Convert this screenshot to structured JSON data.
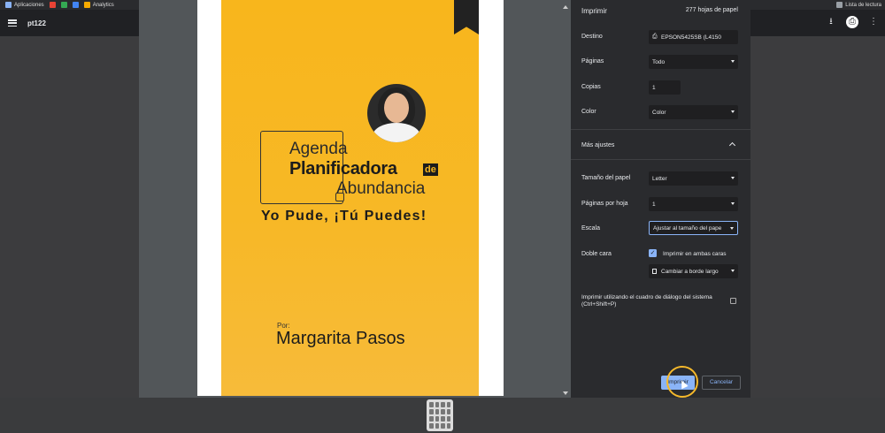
{
  "bookmarks": {
    "apps_label": "Aplicaciones",
    "analytics_label": "Analytics",
    "reading_list_label": "Lista de lectura"
  },
  "toolbar": {
    "doc_title": "pt122"
  },
  "cover": {
    "line1": "Agenda",
    "line2": "Planificadora",
    "line2_suffix": "de",
    "line3": "Abundancia",
    "slogan": "Yo Pude, ¡Tú Puedes!",
    "by": "Por:",
    "author": "Margarita Pasos"
  },
  "print_panel": {
    "title": "Imprimir",
    "sheet_count": "277 hojas de papel",
    "destination": {
      "label": "Destino",
      "value": "EPSON5425SB (L4150"
    },
    "pages": {
      "label": "Páginas",
      "value": "Todo"
    },
    "copies": {
      "label": "Copias",
      "value": "1"
    },
    "color": {
      "label": "Color",
      "value": "Color"
    },
    "more_settings": "Más ajustes",
    "paper_size": {
      "label": "Tamaño del papel",
      "value": "Letter"
    },
    "pages_per_sheet": {
      "label": "Páginas por hoja",
      "value": "1"
    },
    "scale": {
      "label": "Escala",
      "value": "Ajustar al tamaño del pape"
    },
    "duplex": {
      "label": "Doble cara",
      "checkbox_label": "Imprimir en ambas caras",
      "flip_value": "Cambiar a borde largo"
    },
    "system_dialog": "Imprimir utilizando el cuadro de diálogo del sistema (Ctrl+Shift+P)",
    "print_button": "Imprimir",
    "cancel_button": "Cancelar"
  },
  "colors": {
    "cover_yellow": "#f8b61c",
    "accent_blue": "#8ab4f8",
    "highlight_ring": "#f6b92b"
  }
}
